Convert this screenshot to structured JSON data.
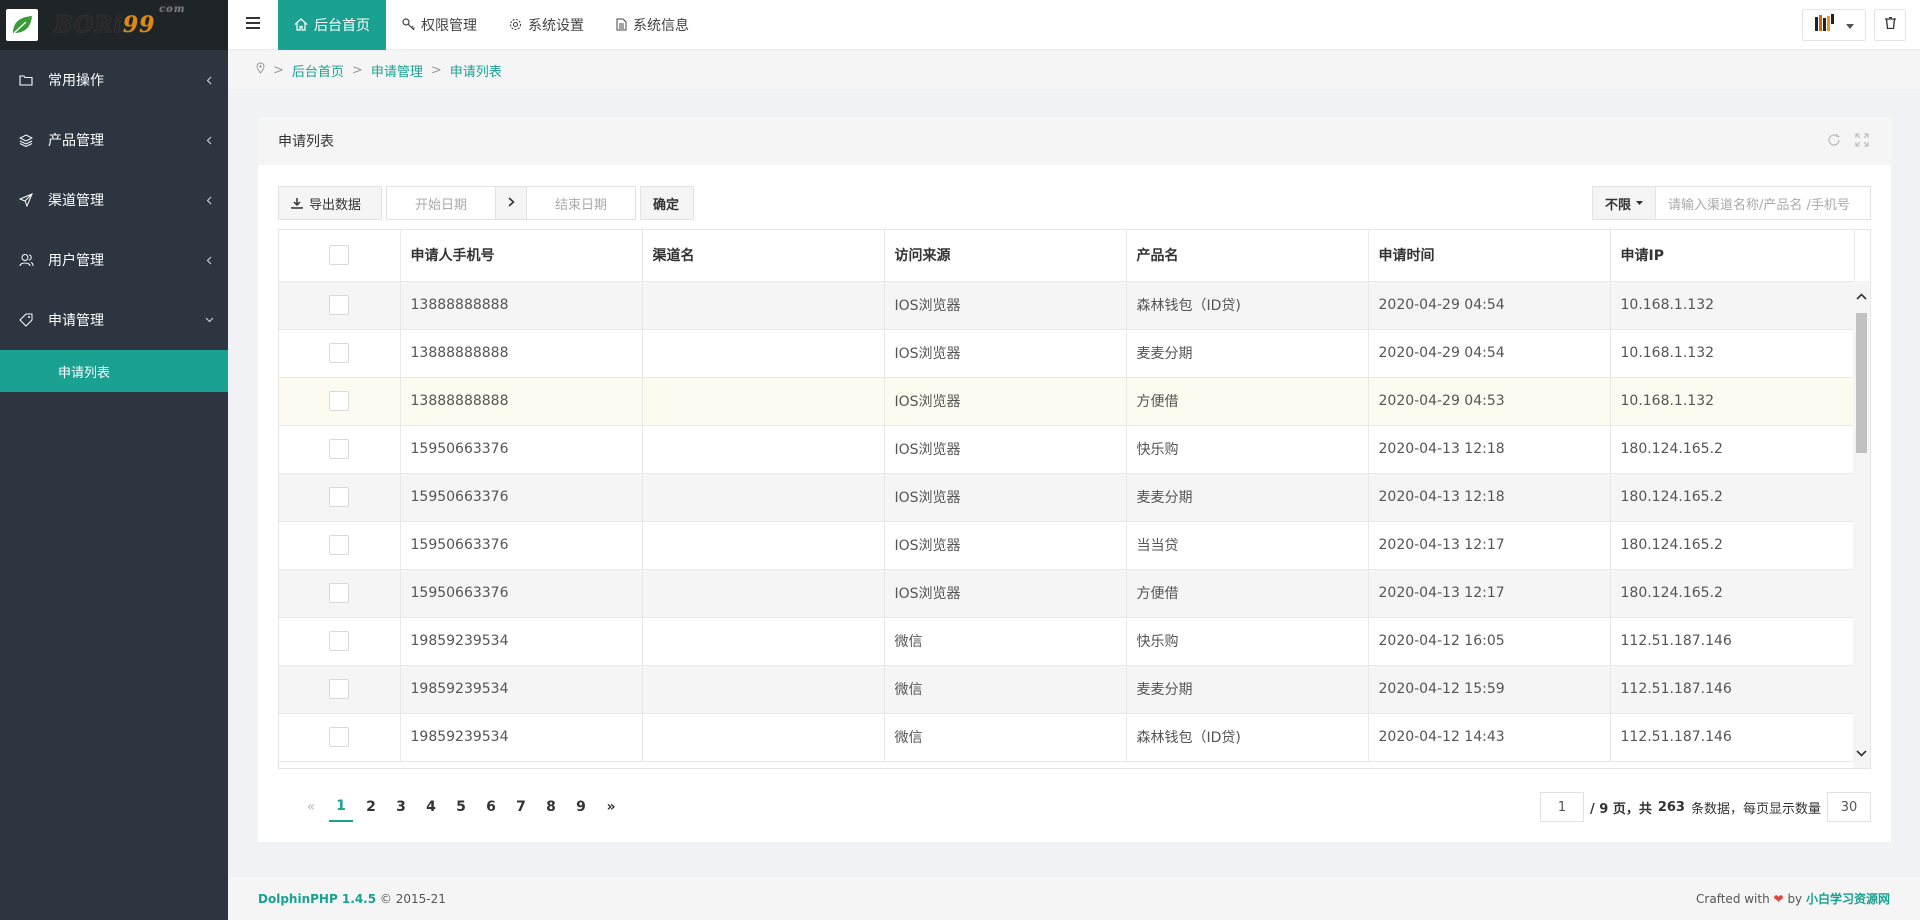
{
  "brand": {
    "logo_main": "BORi",
    "logo_accent": "99",
    "logo_suffix": "com"
  },
  "sidebar": {
    "items": [
      {
        "label": "常用操作",
        "icon": "folder-icon"
      },
      {
        "label": "产品管理",
        "icon": "layers-icon"
      },
      {
        "label": "渠道管理",
        "icon": "send-icon"
      },
      {
        "label": "用户管理",
        "icon": "users-icon"
      },
      {
        "label": "申请管理",
        "icon": "tag-icon"
      }
    ],
    "active_sub": "申请列表"
  },
  "topbar": {
    "tabs": [
      {
        "label": "后台首页",
        "icon": "home-icon",
        "active": true
      },
      {
        "label": "权限管理",
        "icon": "key-icon"
      },
      {
        "label": "系统设置",
        "icon": "gear-icon"
      },
      {
        "label": "系统信息",
        "icon": "file-icon"
      }
    ]
  },
  "breadcrumb": [
    "后台首页",
    "申请管理",
    "申请列表"
  ],
  "card": {
    "title": "申请列表"
  },
  "toolbar": {
    "export_label": "导出数据",
    "start_placeholder": "开始日期",
    "end_placeholder": "结束日期",
    "confirm_label": "确定",
    "filter_value": "不限",
    "search_placeholder": "请输入渠道名称/产品名 /手机号"
  },
  "table": {
    "columns": [
      "申请人手机号",
      "渠道名",
      "访问来源",
      "产品名",
      "申请时间",
      "申请IP"
    ],
    "rows": [
      [
        "13888888888",
        "",
        "IOS浏览器",
        "森林钱包（ID贷)",
        "2020-04-29 04:54",
        "10.168.1.132"
      ],
      [
        "13888888888",
        "",
        "IOS浏览器",
        "麦麦分期",
        "2020-04-29 04:54",
        "10.168.1.132"
      ],
      [
        "13888888888",
        "",
        "IOS浏览器",
        "方便借",
        "2020-04-29 04:53",
        "10.168.1.132"
      ],
      [
        "15950663376",
        "",
        "IOS浏览器",
        "快乐购",
        "2020-04-13 12:18",
        "180.124.165.2"
      ],
      [
        "15950663376",
        "",
        "IOS浏览器",
        "麦麦分期",
        "2020-04-13 12:18",
        "180.124.165.2"
      ],
      [
        "15950663376",
        "",
        "IOS浏览器",
        "当当贷",
        "2020-04-13 12:17",
        "180.124.165.2"
      ],
      [
        "15950663376",
        "",
        "IOS浏览器",
        "方便借",
        "2020-04-13 12:17",
        "180.124.165.2"
      ],
      [
        "19859239534",
        "",
        "微信",
        "快乐购",
        "2020-04-12 16:05",
        "112.51.187.146"
      ],
      [
        "19859239534",
        "",
        "微信",
        "麦麦分期",
        "2020-04-12 15:59",
        "112.51.187.146"
      ],
      [
        "19859239534",
        "",
        "微信",
        "森林钱包（ID贷)",
        "2020-04-12 14:43",
        "112.51.187.146"
      ]
    ]
  },
  "pagination": {
    "prev": "«",
    "pages": [
      "1",
      "2",
      "3",
      "4",
      "5",
      "6",
      "7",
      "8",
      "9"
    ],
    "current": "1",
    "next": "»",
    "page_input": "1",
    "total_pages_text": "/ 9 页，共",
    "total_count": "263",
    "per_page_text": "条数据，每页显示数量",
    "per_page": "30"
  },
  "footer": {
    "brand": "DolphinPHP 1.4.5",
    "copyright": "© 2015-21",
    "crafted": "Crafted with",
    "by": "by",
    "author": "小白学习资源网"
  }
}
